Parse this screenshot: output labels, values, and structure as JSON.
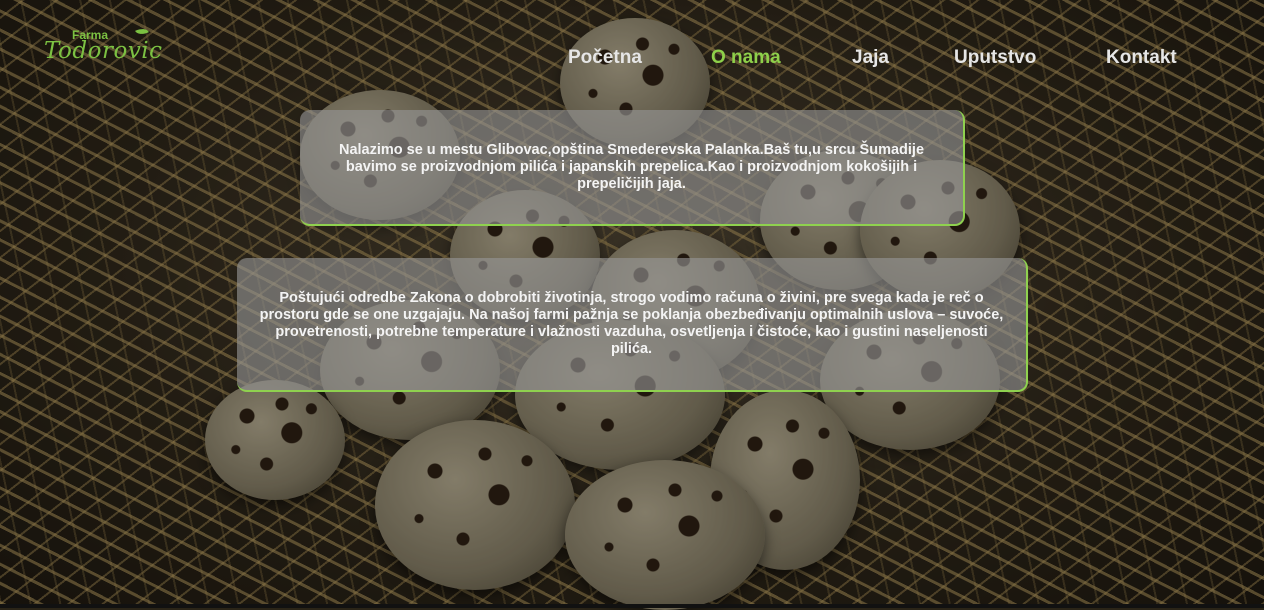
{
  "logo": {
    "top_text": "Farma",
    "main_text": "Todorovic"
  },
  "nav": {
    "items": [
      {
        "label": "Početna",
        "active": false
      },
      {
        "label": "O nama",
        "active": true
      },
      {
        "label": "Jaja",
        "active": false
      },
      {
        "label": "Uputstvo",
        "active": false
      },
      {
        "label": "Kontakt",
        "active": false
      }
    ],
    "active_color": "#8ed04a"
  },
  "content": {
    "paragraph_1": "Nalazimo se u mestu Glibovac,opština Smederevska Palanka.Baš tu,u srcu Šumadije bavimo se proizvodnjom pilića i japanskih prepelica.Kao i proizvodnjom kokošijih i prepeličijih jaja.",
    "paragraph_2": "Poštujući odredbe Zakona o dobrobiti životinja, strogo vodimo računa o živini, pre svega kada je reč o prostoru gde se one uzgajaju. Na našoj farmi pažnja se poklanja obezbeđivanju optimalnih uslova – suvoće, provetrenosti, potrebne temperature i vlažnosti vazduha, osvetljenja i čistoće, kao i gustini naseljenosti pilića."
  },
  "colors": {
    "accent": "#8fd14f",
    "panel_bg": "rgba(150,150,150,0.62)"
  }
}
